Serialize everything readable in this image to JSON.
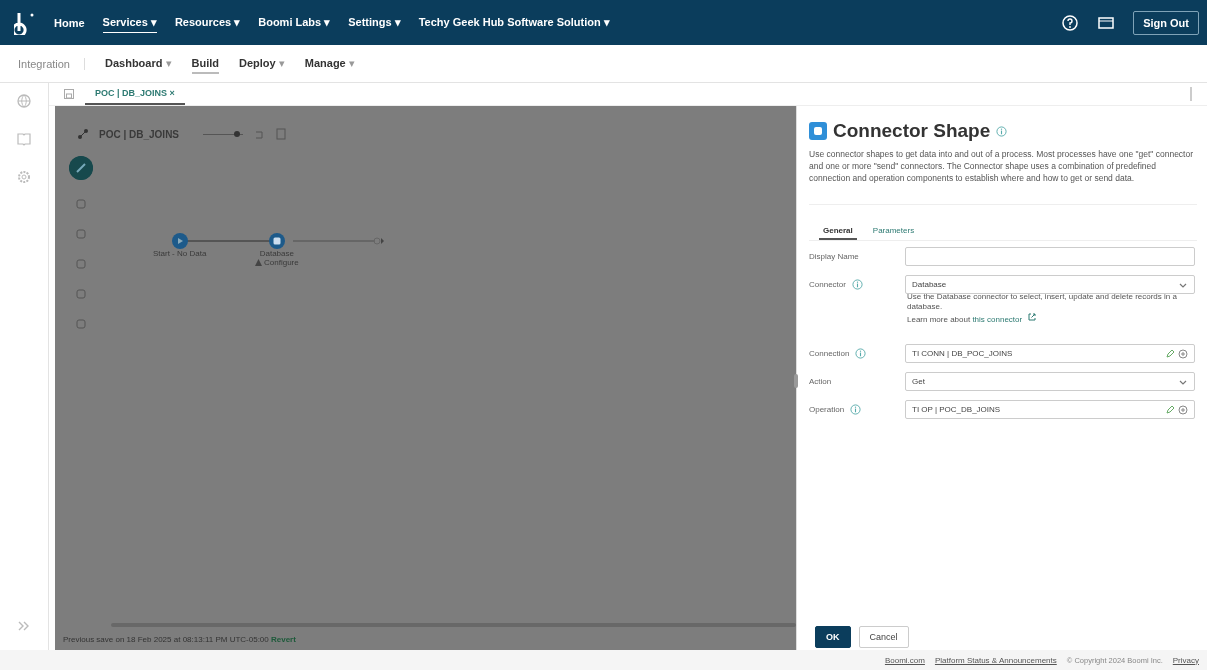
{
  "top_nav": {
    "items": [
      {
        "label": "Home",
        "selected": false
      },
      {
        "label": "Services",
        "caret": "▾",
        "selected": true
      },
      {
        "label": "Resources",
        "caret": "▾",
        "selected": false
      },
      {
        "label": "Boomi Labs",
        "caret": "▾",
        "selected": false
      },
      {
        "label": "Settings",
        "caret": "▾",
        "selected": false
      },
      {
        "label": "Techy Geek Hub Software Solution",
        "caret": "▾",
        "selected": false
      }
    ],
    "sign_out": "Sign Out"
  },
  "sub_nav": {
    "section": "Integration",
    "items": [
      {
        "label": "Dashboard",
        "caret": "▾",
        "selected": false
      },
      {
        "label": "Build",
        "selected": true
      },
      {
        "label": "Deploy",
        "caret": "▾",
        "selected": false
      },
      {
        "label": "Manage",
        "caret": "▾",
        "selected": false
      }
    ]
  },
  "doc_tabs": [
    {
      "label": "POC | DB_JOINS",
      "close": "×",
      "selected": true
    }
  ],
  "canvas": {
    "process_title": "POC | DB_JOINS",
    "zoom": {
      "level": 0.85
    },
    "nodes": [
      {
        "kind": "start",
        "label": "Start - No Data",
        "warning": false
      },
      {
        "kind": "connector",
        "label": "Database",
        "sublabel": "Configure",
        "warning": true
      }
    ],
    "status": {
      "text": "Previous save on 18 Feb 2025 at 08:13:11 PM UTC-05:00",
      "link": "Revert"
    }
  },
  "panel": {
    "title": "Connector Shape",
    "description": "Use connector shapes to get data into and out of a process. Most processes have one \"get\" connector and one or more \"send\" connectors. The Connector shape uses a combination of predefined connection and operation components to establish where and how to get or send data.",
    "tabs": [
      {
        "label": "General",
        "selected": true
      },
      {
        "label": "Parameters",
        "selected": false
      }
    ],
    "fields": [
      {
        "kind": "text",
        "label": "Display Name",
        "info": false
      },
      {
        "kind": "select",
        "label": "Connector",
        "info": true,
        "value": "Database",
        "help": "Use the Database connector to select, insert, update and delete records in a database.",
        "learn_more": "Learn more about",
        "link": "this connector"
      },
      {
        "kind": "component",
        "label": "Connection",
        "info": true,
        "value": "TI CONN | DB_POC_JOINS"
      },
      {
        "kind": "select",
        "label": "Action",
        "info": false,
        "value": "Get"
      },
      {
        "kind": "component",
        "label": "Operation",
        "info": true,
        "value": "TI OP | POC_DB_JOINS"
      }
    ],
    "buttons": [
      {
        "label": "OK",
        "kind": "primary"
      },
      {
        "label": "Cancel",
        "kind": "secondary"
      }
    ]
  },
  "footer": {
    "links": [
      "Boomi.com",
      "Platform Status & Announcements"
    ],
    "copyright": "© Copyright 2024 Boomi Inc.",
    "privacy": "Privacy"
  }
}
